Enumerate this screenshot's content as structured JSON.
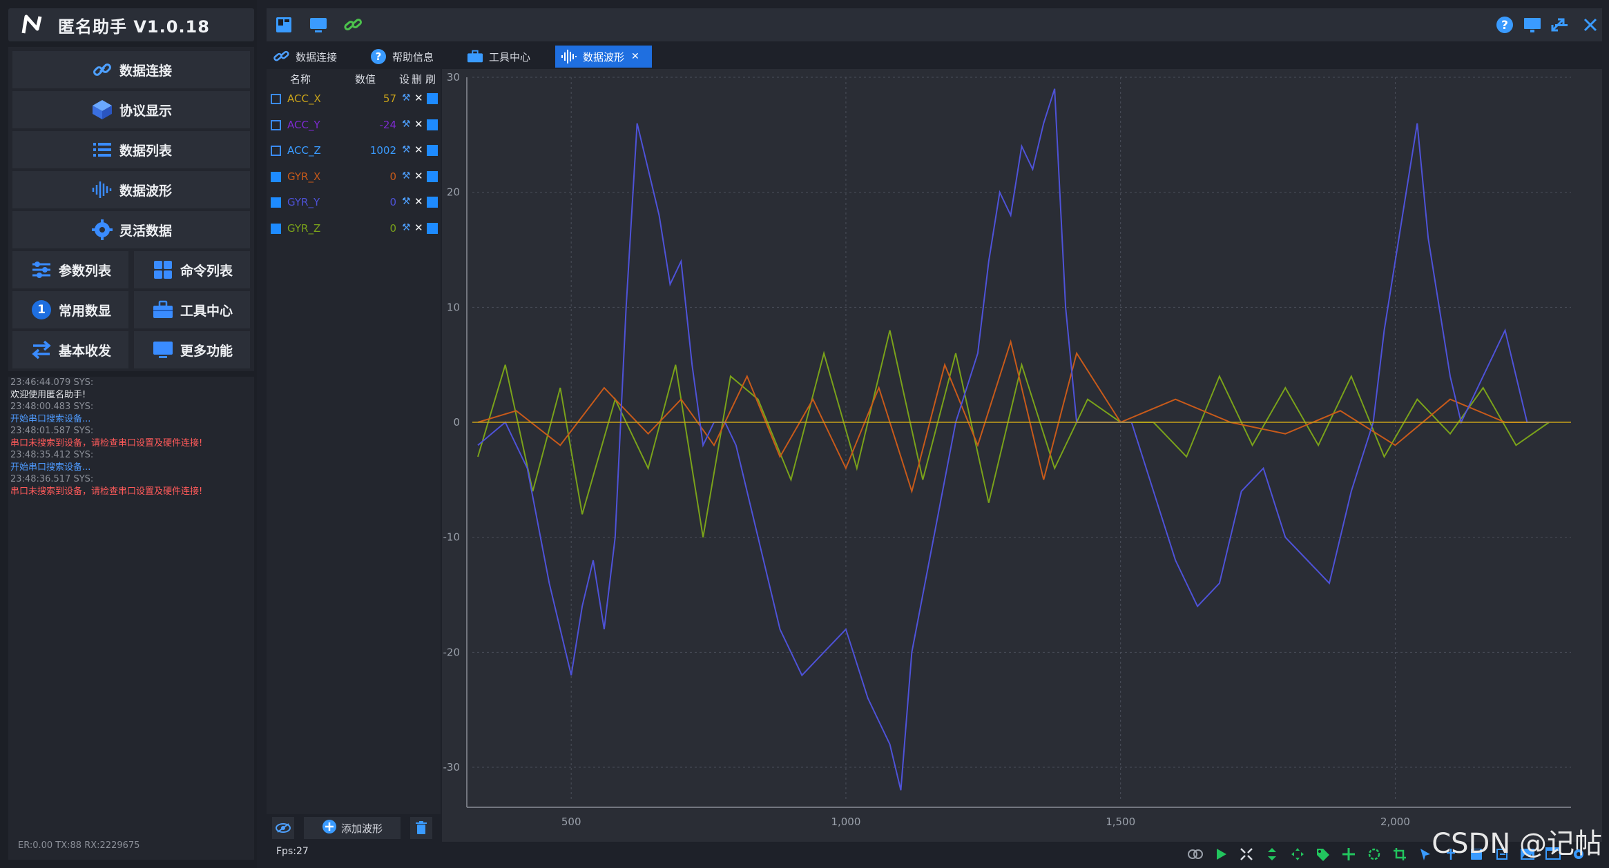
{
  "app": {
    "title": "匿名助手   V1.0.18"
  },
  "menu": {
    "data_connect": "数据连接",
    "protocol_display": "协议显示",
    "data_list": "数据列表",
    "data_wave": "数据波形",
    "flex_data": "灵活数据",
    "param_list": "参数列表",
    "command_list": "命令列表",
    "common_display": "常用数显",
    "common_badge": "1",
    "tool_center": "工具中心",
    "basic_txrx": "基本收发",
    "more": "更多功能"
  },
  "console": [
    {
      "type": "time",
      "text": "23:46:44.079 SYS:"
    },
    {
      "type": "norm",
      "text": "欢迎使用匿名助手!"
    },
    {
      "type": "time",
      "text": "23:48:00.483 SYS:"
    },
    {
      "type": "info",
      "text": "开始串口搜索设备..."
    },
    {
      "type": "time",
      "text": "23:48:01.587 SYS:"
    },
    {
      "type": "err",
      "text": "串口未搜索到设备，请检查串口设置及硬件连接!"
    },
    {
      "type": "time",
      "text": "23:48:35.412 SYS:"
    },
    {
      "type": "info",
      "text": "开始串口搜索设备..."
    },
    {
      "type": "time",
      "text": "23:48:36.517 SYS:"
    },
    {
      "type": "err",
      "text": "串口未搜索到设备，请检查串口设置及硬件连接!"
    }
  ],
  "status": {
    "text": "ER:0.00  TX:88  RX:2229675"
  },
  "tabs": [
    {
      "label": "数据连接",
      "icon": "link-icon",
      "active": false
    },
    {
      "label": "帮助信息",
      "icon": "help-icon",
      "active": false
    },
    {
      "label": "工具中心",
      "icon": "toolbox-icon",
      "active": false
    },
    {
      "label": "数据波形",
      "icon": "wave-icon",
      "active": true
    }
  ],
  "channels": {
    "headers": {
      "name": "名称",
      "value": "数值",
      "set": "设",
      "del": "删",
      "color": "刷"
    },
    "rows": [
      {
        "name": "ACC_X",
        "value": "57",
        "checked": false,
        "color": "#c8a21a"
      },
      {
        "name": "ACC_Y",
        "value": "-24",
        "checked": false,
        "color": "#7d2ad0"
      },
      {
        "name": "ACC_Z",
        "value": "1002",
        "checked": false,
        "color": "#3a9bff"
      },
      {
        "name": "GYR_X",
        "value": "0",
        "checked": true,
        "color": "#c85a1a"
      },
      {
        "name": "GYR_Y",
        "value": "0",
        "checked": true,
        "color": "#4e52d8"
      },
      {
        "name": "GYR_Z",
        "value": "0",
        "checked": true,
        "color": "#7aa21a"
      }
    ],
    "add_label": "添加波形"
  },
  "bottom": {
    "fps": "Fps:27"
  },
  "watermark": "CSDN @记帖",
  "chart_data": {
    "type": "line",
    "xlim": [
      320,
      2320
    ],
    "ylim": [
      -33,
      30
    ],
    "x_ticks": [
      500,
      1000,
      1500,
      2000
    ],
    "x_tick_labels": [
      "500",
      "1,000",
      "1,500",
      "2,000"
    ],
    "y_ticks": [
      -30,
      -20,
      -10,
      0,
      10,
      20,
      30
    ],
    "grid": true,
    "series": [
      {
        "name": "GYR_Y",
        "color": "#4e52d8",
        "x": [
          330,
          380,
          420,
          460,
          500,
          520,
          540,
          560,
          580,
          600,
          620,
          640,
          660,
          680,
          700,
          720,
          740,
          760,
          780,
          800,
          840,
          880,
          920,
          960,
          1000,
          1040,
          1080,
          1100,
          1120,
          1160,
          1200,
          1240,
          1260,
          1280,
          1300,
          1320,
          1340,
          1360,
          1380,
          1400,
          1420,
          1440,
          1460,
          1480,
          1520,
          1560,
          1600,
          1640,
          1680,
          1720,
          1760,
          1800,
          1840,
          1880,
          1920,
          1960,
          1980,
          2000,
          2020,
          2040,
          2060,
          2080,
          2100,
          2120,
          2160,
          2200,
          2240,
          2280
        ],
        "y": [
          -2,
          0,
          -4,
          -14,
          -22,
          -16,
          -12,
          -18,
          -10,
          10,
          26,
          22,
          18,
          12,
          14,
          5,
          -2,
          0,
          0,
          -2,
          -10,
          -18,
          -22,
          -20,
          -18,
          -24,
          -28,
          -32,
          -20,
          -10,
          0,
          6,
          14,
          20,
          18,
          24,
          22,
          26,
          29,
          10,
          0,
          0,
          0,
          0,
          0,
          -6,
          -12,
          -16,
          -14,
          -6,
          -4,
          -10,
          -12,
          -14,
          -6,
          0,
          8,
          14,
          20,
          26,
          16,
          10,
          4,
          0,
          4,
          8,
          0,
          0
        ]
      },
      {
        "name": "GYR_X",
        "color": "#c85a1a",
        "x": [
          330,
          400,
          480,
          560,
          640,
          700,
          760,
          820,
          880,
          940,
          1000,
          1060,
          1120,
          1180,
          1240,
          1300,
          1360,
          1420,
          1500,
          1600,
          1700,
          1800,
          1900,
          2000,
          2100,
          2200,
          2280
        ],
        "y": [
          0,
          1,
          -2,
          3,
          -1,
          2,
          -2,
          4,
          -3,
          2,
          -4,
          3,
          -6,
          5,
          -2,
          7,
          -5,
          6,
          0,
          2,
          0,
          -1,
          1,
          -2,
          2,
          0,
          0
        ]
      },
      {
        "name": "GYR_Z",
        "color": "#7aa21a",
        "x": [
          330,
          380,
          430,
          480,
          520,
          580,
          640,
          690,
          740,
          790,
          840,
          900,
          960,
          1020,
          1080,
          1140,
          1200,
          1260,
          1320,
          1380,
          1440,
          1500,
          1560,
          1620,
          1680,
          1740,
          1800,
          1860,
          1920,
          1980,
          2040,
          2100,
          2160,
          2220,
          2280
        ],
        "y": [
          -3,
          5,
          -6,
          3,
          -8,
          2,
          -4,
          5,
          -10,
          4,
          2,
          -5,
          6,
          -4,
          8,
          -5,
          6,
          -7,
          5,
          -4,
          2,
          0,
          0,
          -3,
          4,
          -2,
          3,
          -2,
          4,
          -3,
          2,
          -1,
          3,
          -2,
          0
        ]
      }
    ]
  }
}
